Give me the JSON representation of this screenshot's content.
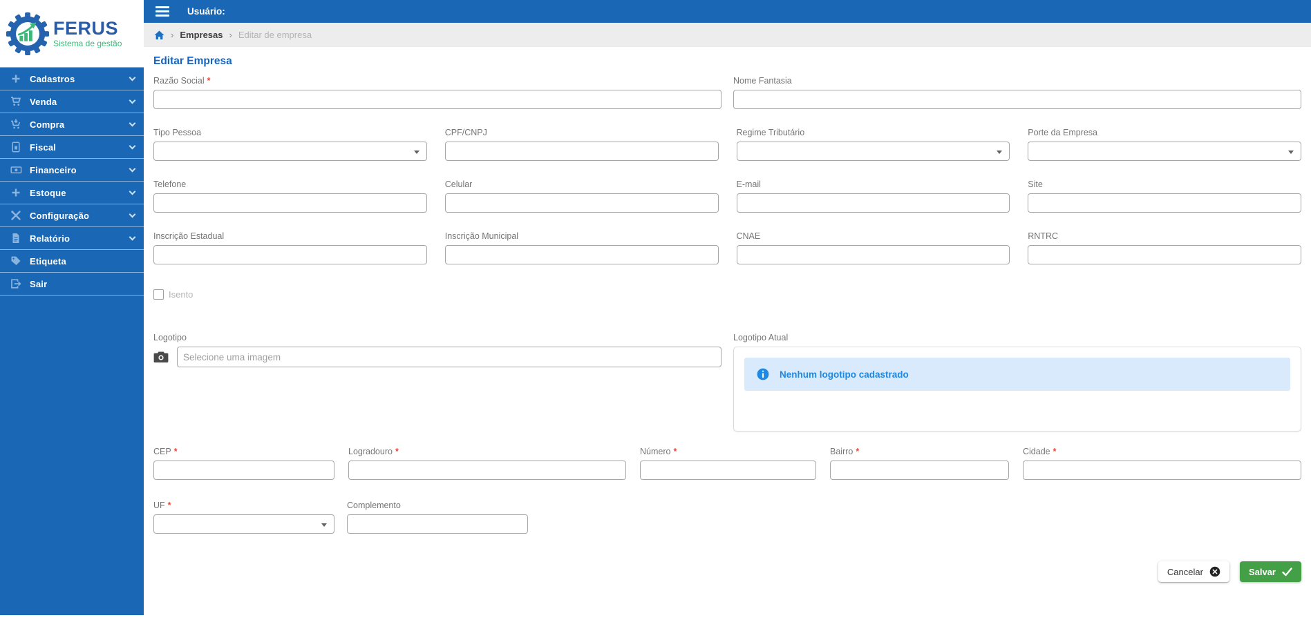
{
  "brand": {
    "name": "FERUS",
    "tagline": "Sistema de gestão"
  },
  "topbar": {
    "user_label": "Usuário:"
  },
  "breadcrumb": {
    "items": [
      {
        "label": "Empresas"
      },
      {
        "label": "Editar de empresa"
      }
    ]
  },
  "page": {
    "title": "Editar Empresa"
  },
  "ui": {
    "required_marker": "*",
    "breadcrumb_separator": "›"
  },
  "sidebar": {
    "items": [
      {
        "label": "Cadastros",
        "icon": "plus",
        "expandable": true
      },
      {
        "label": "Venda",
        "icon": "shopping-cart",
        "expandable": true
      },
      {
        "label": "Compra",
        "icon": "cart-arrow-down",
        "expandable": true
      },
      {
        "label": "Fiscal",
        "icon": "file-invoice",
        "expandable": true
      },
      {
        "label": "Financeiro",
        "icon": "money-bill",
        "expandable": true
      },
      {
        "label": "Estoque",
        "icon": "plus",
        "expandable": true
      },
      {
        "label": "Configuração",
        "icon": "tools",
        "expandable": true
      },
      {
        "label": "Relatório",
        "icon": "file-alt",
        "expandable": true
      },
      {
        "label": "Etiqueta",
        "icon": "tag",
        "expandable": false
      },
      {
        "label": "Sair",
        "icon": "sign-out",
        "expandable": false
      }
    ]
  },
  "form": {
    "razao_social": {
      "label": "Razão Social",
      "required": true,
      "value": ""
    },
    "nome_fantasia": {
      "label": "Nome Fantasia",
      "value": ""
    },
    "tipo_pessoa": {
      "label": "Tipo Pessoa",
      "type": "select",
      "value": ""
    },
    "cpf_cnpj": {
      "label": "CPF/CNPJ",
      "value": ""
    },
    "regime_tributario": {
      "label": "Regime Tributário",
      "type": "select",
      "value": ""
    },
    "porte_empresa": {
      "label": "Porte da Empresa",
      "type": "select",
      "value": ""
    },
    "telefone": {
      "label": "Telefone",
      "value": ""
    },
    "celular": {
      "label": "Celular",
      "value": ""
    },
    "email": {
      "label": "E-mail",
      "value": ""
    },
    "site": {
      "label": "Site",
      "value": ""
    },
    "inscricao_estadual": {
      "label": "Inscrição Estadual",
      "value": ""
    },
    "inscricao_municipal": {
      "label": "Inscrição Municipal",
      "value": ""
    },
    "cnae": {
      "label": "CNAE",
      "value": ""
    },
    "rntrc": {
      "label": "RNTRC",
      "value": ""
    },
    "isento": {
      "label": "Isento",
      "checked": false
    },
    "logotipo": {
      "label": "Logotipo",
      "placeholder": "Selecione uma imagem",
      "value": ""
    },
    "logotipo_atual": {
      "label": "Logotipo Atual",
      "alert_text": "Nenhum logotipo cadastrado"
    },
    "cep": {
      "label": "CEP",
      "required": true,
      "value": ""
    },
    "logradouro": {
      "label": "Logradouro",
      "required": true,
      "value": ""
    },
    "numero": {
      "label": "Número",
      "required": true,
      "value": ""
    },
    "bairro": {
      "label": "Bairro",
      "required": true,
      "value": ""
    },
    "cidade": {
      "label": "Cidade",
      "required": true,
      "value": ""
    },
    "uf": {
      "label": "UF",
      "required": true,
      "type": "select",
      "value": ""
    },
    "complemento": {
      "label": "Complemento",
      "value": ""
    }
  },
  "actions": {
    "cancel": "Cancelar",
    "save": "Salvar"
  },
  "icons": {
    "menu_toggle": "hamburger",
    "breadcrumb_home": "house",
    "logotipo_prefix": "camera",
    "alert": "info-circle",
    "cancel_button": "times-circle",
    "save_button": "check",
    "dropdown": "caret-down"
  },
  "colors": {
    "primary_blue": "#1a68b5",
    "title_blue": "#1565c0",
    "alert_blue": "#1e88e5",
    "alert_bg": "#d8eafc",
    "save_green": "#43a047",
    "required_red": "#f44336",
    "logo_blue": "#2a5ca8",
    "logo_green": "#3cb878",
    "breadcrumb_bg": "#ededed"
  }
}
